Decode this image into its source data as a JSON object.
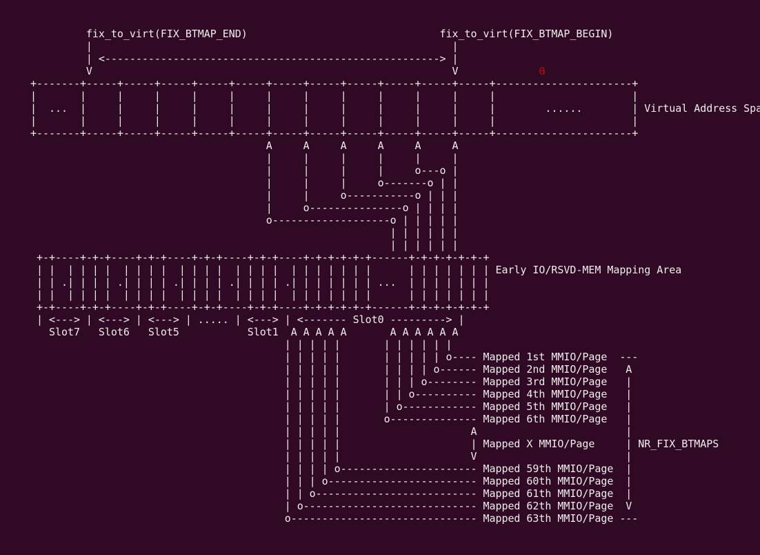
{
  "diagram": {
    "title_end": "fix_to_virt(FIX_BTMAP_END)",
    "title_begin": "fix_to_virt(FIX_BTMAP_BEGIN)",
    "zero_marker": "0",
    "lines": [
      "         fix_to_virt(FIX_BTMAP_END)                               fix_to_virt(FIX_BTMAP_BEGIN)",
      "         |                                                          |",
      "         | <------------------------------------------------------> |",
      "         V                                                          V             0",
      "+-------+-----+-----+-----+-----+-----+-----+-----+-----+-----+-----+-----+----------------------+",
      "|       |     |     |     |     |     |     |     |     |     |     |     |                      |",
      "|  ...  |     |     |     |     |     |     |     |     |     |     |     |        ......        | Virtual Address Space",
      "|       |     |     |     |     |     |     |     |     |     |     |     |                      |",
      "+-------+-----+-----+-----+-----+-----+-----+-----+-----+-----+-----+-----+----------------------+",
      "                                      A     A     A     A     A     A",
      "                                      |     |     |     |     |     |",
      "                                      |     |     |     |     o---o |",
      "                                      |     |     |     o-------o | |",
      "                                      |     |     o-----------o | | |",
      "                                      |     o---------------o | | | |",
      "                                      o-------------------o | | | | |",
      "                                                          | | | | | |",
      "                                                          | | | | | |",
      " +-+----+-+-+----+-+-+----+-+-+----+-+-+----+-+-+-+-+-+------+-+-+-+-+-+-+",
      " | |  | | | |  | | | |  | | | |  | | | |  | | | | | | |      | | | | | | | Early IO/RSVD-MEM Mapping Area",
      " | | .| | | | .| | | | .| | | | .| | | | .| | | | | | | ...  | | | | | | |",
      " | |  | | | |  | | | |  | | | |  | | | |  | | | | | | |      | | | | | | |",
      " +-+----+-+-+----+-+-+----+-+-+----+-+-+----+-+-+-+-+-+------+-+-+-+-+-+-+",
      " | <---> | <---> | <---> | ..... | <---> | <------- Slot0 ---------> |",
      "   Slot7   Slot6   Slot5           Slot1  A A A A A       A A A A A A",
      "                                         | | | | |       | | | | | |",
      "                                         | | | | |       | | | | | o---- Mapped 1st MMIO/Page  ---",
      "                                         | | | | |       | | | | o------ Mapped 2nd MMIO/Page   A",
      "                                         | | | | |       | | | o-------- Mapped 3rd MMIO/Page   |",
      "                                         | | | | |       | | o---------- Mapped 4th MMIO/Page   |",
      "                                         | | | | |       | o------------ Mapped 5th MMIO/Page   |",
      "                                         | | | | |       o-------------- Mapped 6th MMIO/Page   |",
      "                                         | | | | |                     A                        |",
      "                                         | | | | |                     | Mapped X MMIO/Page     | NR_FIX_BTMAPS",
      "                                         | | | | |                     V                        |",
      "                                         | | | | o---------------------- Mapped 59th MMIO/Page  |",
      "                                         | | | o------------------------ Mapped 60th MMIO/Page  |",
      "                                         | | o-------------------------- Mapped 61th MMIO/Page  |",
      "                                         | o---------------------------- Mapped 62th MMIO/Page  V",
      "                                         o------------------------------ Mapped 63th MMIO/Page ---"
    ]
  }
}
